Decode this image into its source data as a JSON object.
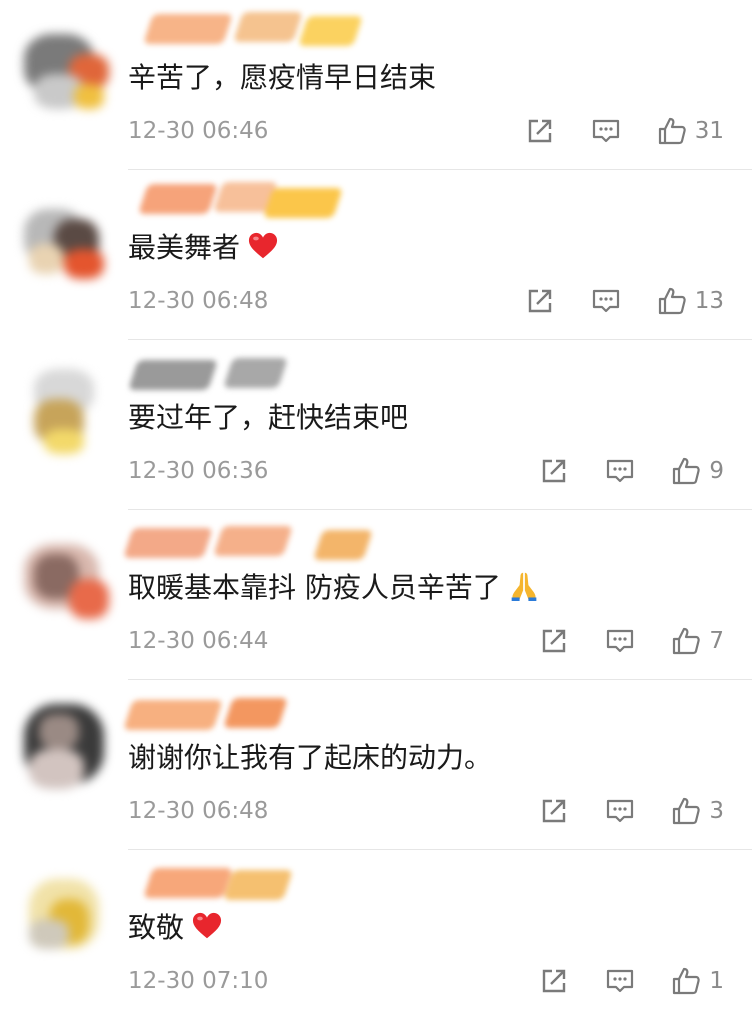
{
  "comments": [
    {
      "text": "辛苦了，愿疫情早日结束",
      "emoji": "",
      "time": "12-30 06:46",
      "likes": "31"
    },
    {
      "text": "最美舞者",
      "emoji": "heart",
      "time": "12-30 06:48",
      "likes": "13"
    },
    {
      "text": "要过年了，赶快结束吧",
      "emoji": "",
      "time": "12-30 06:36",
      "likes": "9"
    },
    {
      "text": "取暖基本靠抖  防疫人员辛苦了",
      "emoji": "pray",
      "time": "12-30 06:44",
      "likes": "7"
    },
    {
      "text": "谢谢你让我有了起床的动力。",
      "emoji": "",
      "time": "12-30 06:48",
      "likes": "3"
    },
    {
      "text": "致敬",
      "emoji": "heart",
      "time": "12-30 07:10",
      "likes": "1"
    }
  ],
  "icons": {
    "share": "share-icon",
    "reply": "comment-icon",
    "like": "thumbs-up-icon",
    "heart_emoji": "red-heart-icon",
    "pray_emoji": "praying-hands-icon"
  },
  "colors": {
    "text": "#1a1a1a",
    "meta": "#9a9a9a",
    "icon": "#7a7a7a",
    "heart": "#e8262d",
    "divider": "#e6e6e6"
  }
}
